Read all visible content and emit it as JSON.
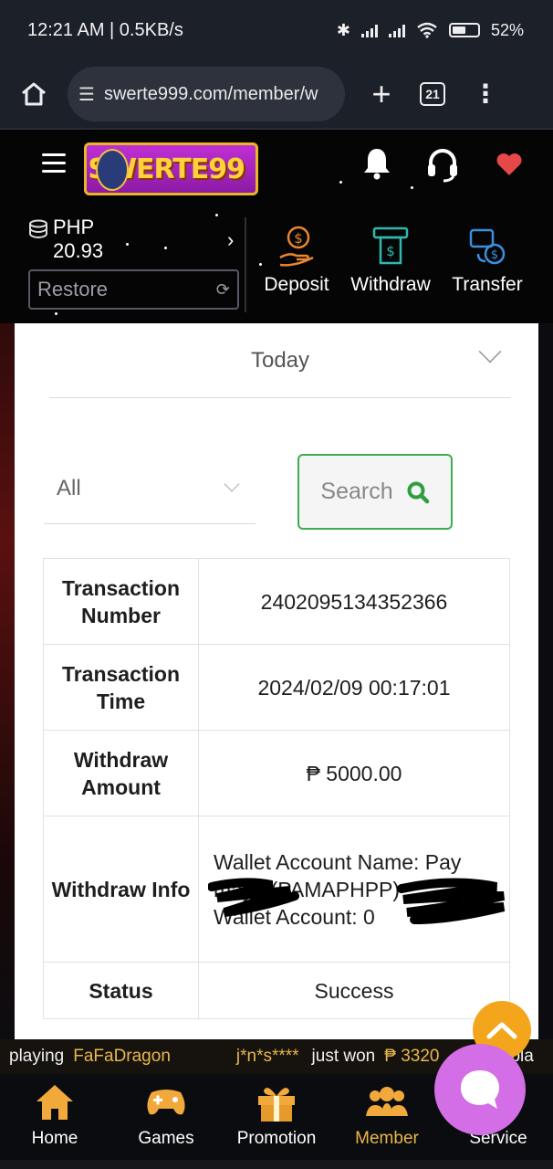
{
  "status_bar": {
    "time_speed": "12:21 AM | 0.5KB/s",
    "battery": "52%"
  },
  "browser": {
    "url": "swerte999.com/member/w",
    "tab_count": "21"
  },
  "header": {
    "logo_text": "SWERTE99"
  },
  "wallet": {
    "currency": "PHP",
    "balance": "20.93",
    "restore_label": "Restore",
    "actions": [
      {
        "label": "Deposit",
        "icon": "deposit-icon"
      },
      {
        "label": "Withdraw",
        "icon": "atm-icon"
      },
      {
        "label": "Transfer",
        "icon": "transfer-icon"
      }
    ]
  },
  "filters": {
    "date_range": "Today",
    "type": "All",
    "search_label": "Search"
  },
  "transaction": {
    "rows": [
      {
        "label": "Transaction Number",
        "value": "2402095134352366"
      },
      {
        "label": "Transaction Time",
        "value": "2024/02/09 00:17:01"
      },
      {
        "label": "Withdraw Amount",
        "value": "₱ 5000.00"
      },
      {
        "label": "Withdraw Info",
        "value_line1": "Wallet Account Name: Pay",
        "value_line2": "maya (PAMAPHPP)",
        "value_line3": "Wallet Account: 0"
      },
      {
        "label": "Status",
        "value": "Success"
      }
    ]
  },
  "ticker": {
    "part1": "playing",
    "game": "FaFaDragon",
    "user": "j*n*s****",
    "just_won": "just won",
    "amount": "₱ 3320",
    "tail": "pla"
  },
  "bottom_nav": [
    {
      "label": "Home"
    },
    {
      "label": "Games"
    },
    {
      "label": "Promotion"
    },
    {
      "label": "Member"
    },
    {
      "label": "Service"
    }
  ],
  "colors": {
    "accent_green": "#3dae4f",
    "member_active": "#e8b74a",
    "scroll_top": "#f3a51c",
    "chat": "#d46ee6"
  }
}
